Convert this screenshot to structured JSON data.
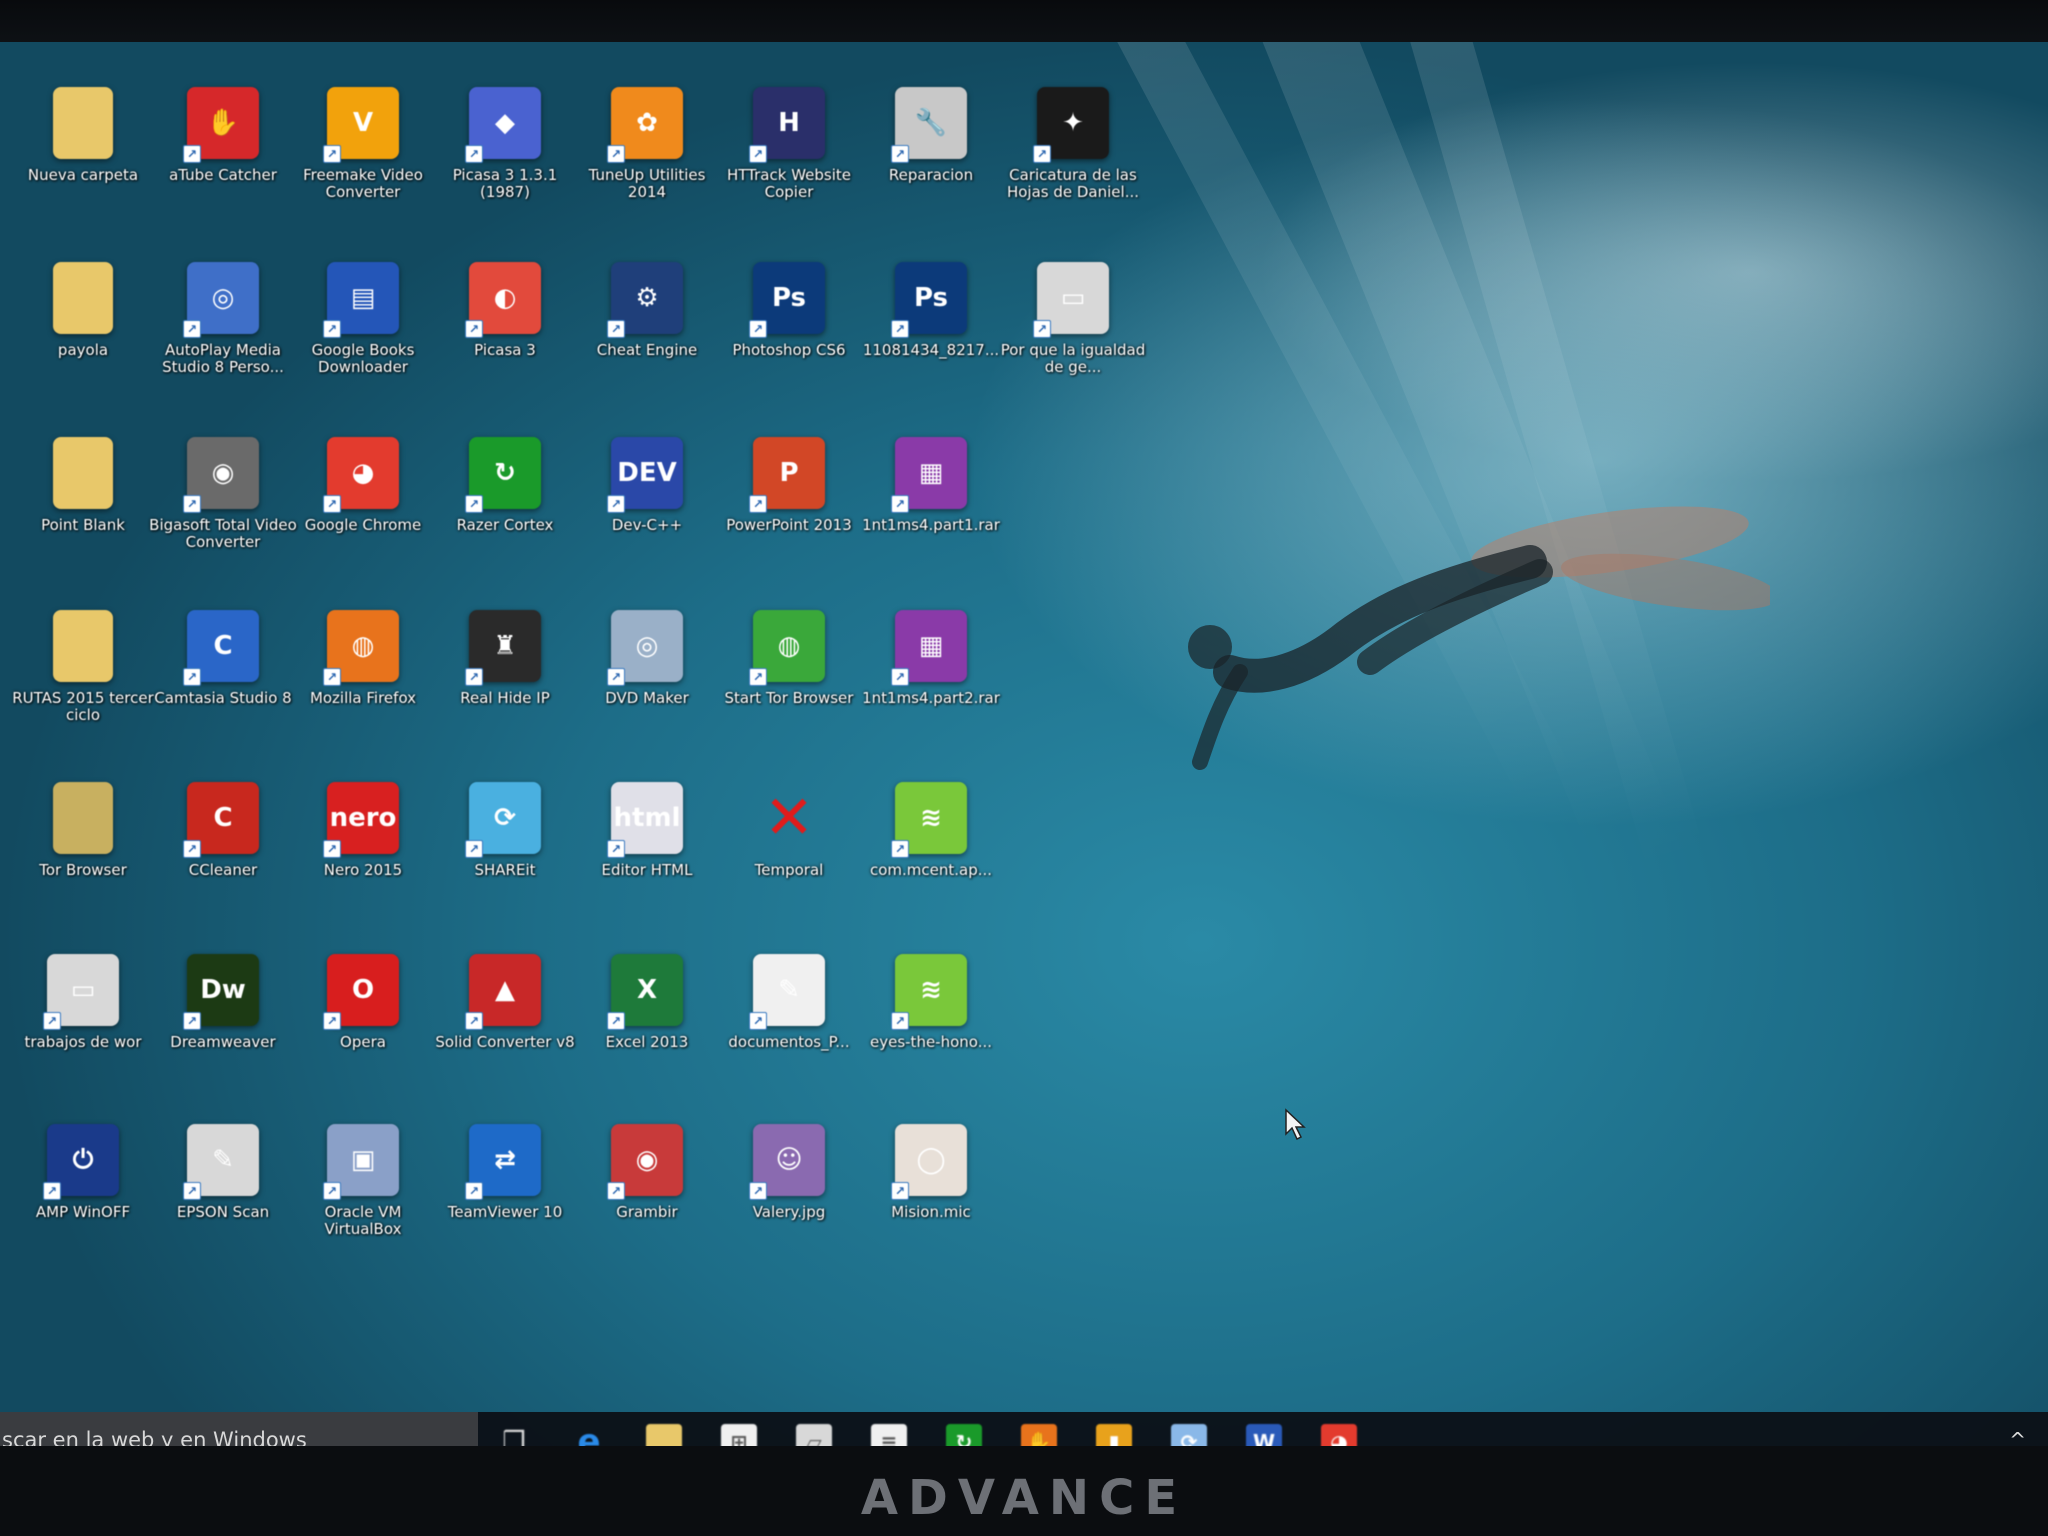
{
  "monitor": {
    "brand": "ADVANCE"
  },
  "desktop": {
    "icons": [
      {
        "label": "Nueva carpeta",
        "icon": "folder-icon",
        "color": "#e8c86a",
        "glyph": ""
      },
      {
        "label": "aTube Catcher",
        "icon": "hand-icon",
        "color": "#d6282a",
        "glyph": "✋"
      },
      {
        "label": "Freemake Video Converter",
        "icon": "freemake-icon",
        "color": "#f2a20c",
        "glyph": "V"
      },
      {
        "label": "Picasa 3 1.3.1 (1987)",
        "icon": "picasa-blocks-icon",
        "color": "#4a62d0",
        "glyph": "◆"
      },
      {
        "label": "TuneUp Utilities 2014",
        "icon": "tuneup-icon",
        "color": "#f08a1c",
        "glyph": "✿"
      },
      {
        "label": "HTTrack Website Copier",
        "icon": "httrack-icon",
        "color": "#2a2f6a",
        "glyph": "H"
      },
      {
        "label": "Reparacion",
        "icon": "repair-icon",
        "color": "#c8c8c8",
        "glyph": "🔧"
      },
      {
        "label": "Caricatura de las Hojas de Daniel...",
        "icon": "image-file-icon",
        "color": "#1a1a1a",
        "glyph": "✦"
      },
      {
        "label": "payola",
        "icon": "folder-icon",
        "color": "#e8c86a",
        "glyph": ""
      },
      {
        "label": "AutoPlay Media Studio 8 Perso...",
        "icon": "autoplay-icon",
        "color": "#3f6fc8",
        "glyph": "◎"
      },
      {
        "label": "Google Books Downloader",
        "icon": "books-icon",
        "color": "#2456b8",
        "glyph": "▤"
      },
      {
        "label": "Picasa 3",
        "icon": "picasa-icon",
        "color": "#e24a3c",
        "glyph": "◐"
      },
      {
        "label": "Cheat Engine",
        "icon": "cheat-engine-icon",
        "color": "#1f3f7a",
        "glyph": "⚙"
      },
      {
        "label": "Photoshop CS6",
        "icon": "photoshop-icon",
        "color": "#0c3a7a",
        "glyph": "Ps"
      },
      {
        "label": "11081434_8217...",
        "icon": "photoshop-file-icon",
        "color": "#0c3a7a",
        "glyph": "Ps"
      },
      {
        "label": "Por que la igualdad de ge...",
        "icon": "document-icon",
        "color": "#d8d8d8",
        "glyph": "▭"
      },
      {
        "label": "Point Blank",
        "icon": "folder-icon",
        "color": "#e8c86a",
        "glyph": ""
      },
      {
        "label": "Bigasoft Total Video Converter",
        "icon": "film-reel-icon",
        "color": "#6a6a6a",
        "glyph": "◉"
      },
      {
        "label": "Google Chrome",
        "icon": "chrome-icon",
        "color": "#e33b2e",
        "glyph": "◕"
      },
      {
        "label": "Razer Cortex",
        "icon": "razer-cortex-icon",
        "color": "#1a9a2a",
        "glyph": "↻"
      },
      {
        "label": "Dev-C++",
        "icon": "devcpp-icon",
        "color": "#2a48a8",
        "glyph": "DEV"
      },
      {
        "label": "PowerPoint 2013",
        "icon": "powerpoint-icon",
        "color": "#d24726",
        "glyph": "P"
      },
      {
        "label": "1nt1ms4.part1.rar",
        "icon": "winrar-icon",
        "color": "#8a3aa8",
        "glyph": "▦"
      },
      {
        "label": "",
        "icon": "blank",
        "color": "transparent",
        "glyph": ""
      },
      {
        "label": "RUTAS 2015 tercer ciclo",
        "icon": "folder-icon",
        "color": "#e8c86a",
        "glyph": ""
      },
      {
        "label": "Camtasia Studio 8",
        "icon": "camtasia-icon",
        "color": "#2a66c8",
        "glyph": "C"
      },
      {
        "label": "Mozilla Firefox",
        "icon": "firefox-icon",
        "color": "#e8731c",
        "glyph": "◍"
      },
      {
        "label": "Real Hide IP",
        "icon": "spy-icon",
        "color": "#2a2a2a",
        "glyph": "♜"
      },
      {
        "label": "DVD Maker",
        "icon": "dvd-icon",
        "color": "#9ab0c8",
        "glyph": "◎"
      },
      {
        "label": "Start Tor Browser",
        "icon": "tor-icon",
        "color": "#3aa83a",
        "glyph": "◍"
      },
      {
        "label": "1nt1ms4.part2.rar",
        "icon": "winrar-icon",
        "color": "#8a3aa8",
        "glyph": "▦"
      },
      {
        "label": "",
        "icon": "blank",
        "color": "transparent",
        "glyph": ""
      },
      {
        "label": "Tor Browser",
        "icon": "folder-icon",
        "color": "#c8b060",
        "glyph": ""
      },
      {
        "label": "CCleaner",
        "icon": "ccleaner-icon",
        "color": "#c8281e",
        "glyph": "C"
      },
      {
        "label": "Nero 2015",
        "icon": "nero-icon",
        "color": "#d82020",
        "glyph": "nero"
      },
      {
        "label": "SHAREit",
        "icon": "shareit-icon",
        "color": "#4ab0e0",
        "glyph": "⟳"
      },
      {
        "label": "Editor HTML",
        "icon": "html-editor-icon",
        "color": "#e0e0e8",
        "glyph": "html"
      },
      {
        "label": "Temporal",
        "icon": "x-icon",
        "color": "transparent",
        "glyph": "✕"
      },
      {
        "label": "com.mcent.ap...",
        "icon": "bluestacks-icon",
        "color": "#7ac83a",
        "glyph": "≋"
      },
      {
        "label": "",
        "icon": "blank",
        "color": "transparent",
        "glyph": ""
      },
      {
        "label": "trabajos de wor",
        "icon": "monitor-icon",
        "color": "#d8d8d8",
        "glyph": "▭"
      },
      {
        "label": "Dreamweaver",
        "icon": "dreamweaver-icon",
        "color": "#1c3a14",
        "glyph": "Dw"
      },
      {
        "label": "Opera",
        "icon": "opera-icon",
        "color": "#d81e1e",
        "glyph": "O"
      },
      {
        "label": "Solid Converter v8",
        "icon": "solid-converter-icon",
        "color": "#c82828",
        "glyph": "▲"
      },
      {
        "label": "Excel 2013",
        "icon": "excel-icon",
        "color": "#1e7a3a",
        "glyph": "X"
      },
      {
        "label": "documentos_P...",
        "icon": "pdf-icon",
        "color": "#f0f0f0",
        "glyph": "✎"
      },
      {
        "label": "eyes-the-hono...",
        "icon": "bluestacks-icon",
        "color": "#7ac83a",
        "glyph": "≋"
      },
      {
        "label": "",
        "icon": "blank",
        "color": "transparent",
        "glyph": ""
      },
      {
        "label": "AMP WinOFF",
        "icon": "power-icon",
        "color": "#1a3a8a",
        "glyph": "⏻"
      },
      {
        "label": "EPSON Scan",
        "icon": "scanner-icon",
        "color": "#d8d8d8",
        "glyph": "✎"
      },
      {
        "label": "Oracle VM VirtualBox",
        "icon": "virtualbox-icon",
        "color": "#8aa0c8",
        "glyph": "▣"
      },
      {
        "label": "TeamViewer 10",
        "icon": "teamviewer-icon",
        "color": "#1e6ac8",
        "glyph": "⇄"
      },
      {
        "label": "Grambir",
        "icon": "camera-icon",
        "color": "#c83a3a",
        "glyph": "◉"
      },
      {
        "label": "Valery.jpg",
        "icon": "photo-file-icon",
        "color": "#8a6ab0",
        "glyph": "☺"
      },
      {
        "label": "Mision.mic",
        "icon": "media-file-icon",
        "color": "#e8e0d8",
        "glyph": "◯"
      }
    ]
  },
  "taskbar": {
    "search_placeholder": "scar en la web y en Windows",
    "apps": [
      {
        "name": "task-view-icon",
        "color": "transparent",
        "glyph": "❒"
      },
      {
        "name": "edge-icon",
        "color": "transparent",
        "glyph": "e"
      },
      {
        "name": "file-explorer-icon",
        "color": "#e8c86a",
        "glyph": ""
      },
      {
        "name": "store-icon",
        "color": "#f0f0f0",
        "glyph": "⊞"
      },
      {
        "name": "app-icon",
        "color": "#d8d8d8",
        "glyph": "▱"
      },
      {
        "name": "document-app-icon",
        "color": "#f0f0f0",
        "glyph": "≡"
      },
      {
        "name": "razer-cortex-icon",
        "color": "#1a9a2a",
        "glyph": "↻"
      },
      {
        "name": "hand-icon",
        "color": "#e8731c",
        "glyph": "✋"
      },
      {
        "name": "folder-app-icon",
        "color": "#e8a21c",
        "glyph": "▮"
      },
      {
        "name": "shareit-icon",
        "color": "#8ab8e8",
        "glyph": "⟳"
      },
      {
        "name": "word-icon",
        "color": "#2a5ab8",
        "glyph": "W"
      },
      {
        "name": "chrome-icon",
        "color": "#e33b2e",
        "glyph": "◕"
      }
    ],
    "tray_chevron": "^"
  }
}
